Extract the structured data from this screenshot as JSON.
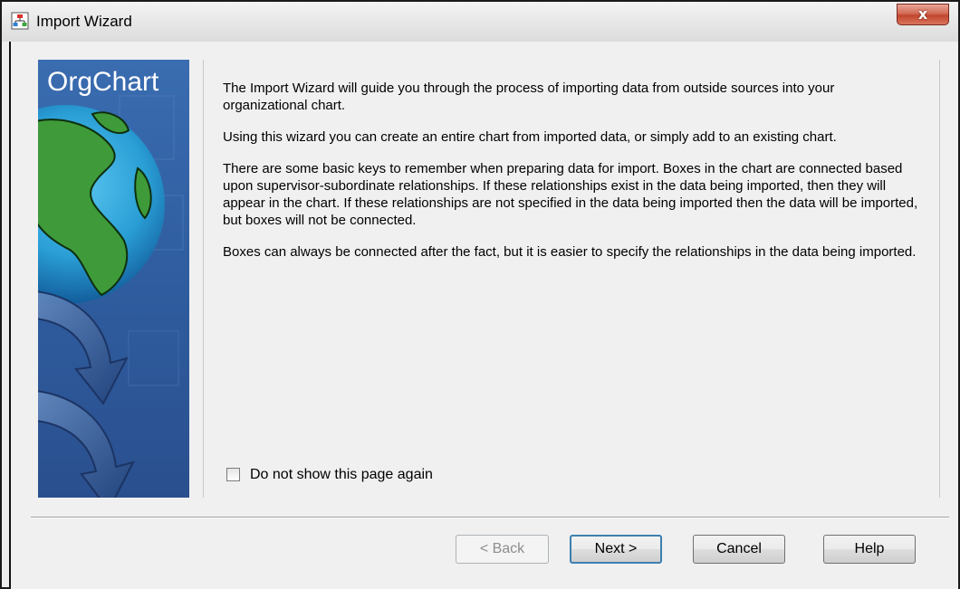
{
  "window": {
    "title": "Import Wizard",
    "close_label": "x"
  },
  "banner": {
    "title": "OrgChart"
  },
  "content": {
    "paragraphs": [
      "The Import Wizard will guide you through the process of importing data from outside sources into your organizational chart.",
      "Using this wizard you can create an entire chart from imported data, or simply add to an existing chart.",
      "There are some basic keys to remember when preparing data for import. Boxes in the chart are connected based upon supervisor-subordinate relationships. If these relationships exist in the data being imported, then they will appear in the chart. If these relationships are not specified in the data being imported then the data will be imported, but boxes will not be connected.",
      "Boxes can always be connected after the fact, but it is easier to specify the relationships in the data being imported."
    ]
  },
  "options": {
    "do_not_show_label": "Do not show this page again",
    "do_not_show_checked": false
  },
  "buttons": {
    "back": "< Back",
    "next": "Next >",
    "cancel": "Cancel",
    "help": "Help"
  },
  "colors": {
    "banner_blue": "#2f5d9f",
    "globe_ocean": "#2a9fd6",
    "globe_land": "#3f9a3a",
    "close_red": "#c2462e",
    "default_button_border": "#3c7fb1"
  },
  "icons": {
    "app": "org-chart-app-icon",
    "close": "close-icon",
    "globe": "globe-icon",
    "arrows": "arrow-icon"
  }
}
